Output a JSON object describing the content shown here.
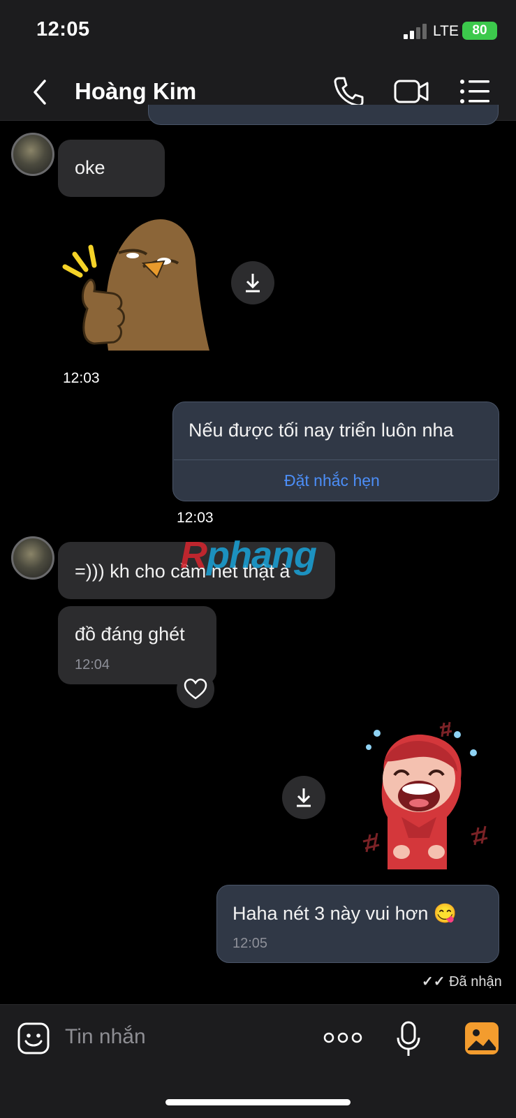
{
  "status_bar": {
    "time": "12:05",
    "network": "LTE",
    "battery": "80"
  },
  "header": {
    "contact_name": "Hoàng Kim",
    "icons": [
      "back-chevron-icon",
      "phone-icon",
      "video-camera-icon",
      "list-menu-icon"
    ]
  },
  "messages": [
    {
      "direction": "received",
      "text": "oke"
    },
    {
      "direction": "received",
      "type": "sticker",
      "sticker": "thumbs-up-bird-sticker",
      "time": "12:03"
    },
    {
      "direction": "sent",
      "text": "Nếu được tối nay triển luôn nha",
      "action": "Đặt nhắc hẹn",
      "time": "12:03"
    },
    {
      "direction": "received",
      "text": "=))) kh cho cầm net thật à"
    },
    {
      "direction": "received",
      "text": "đồ đáng ghét",
      "time": "12:04"
    },
    {
      "direction": "sent",
      "type": "sticker",
      "sticker": "laughing-crying-girl-sticker"
    },
    {
      "direction": "sent",
      "text": "Haha nét 3 này vui hơn 😋",
      "time": "12:05"
    }
  ],
  "delivery_status": "Đã nhận",
  "watermark": "Rphang",
  "input": {
    "placeholder": "Tin nhắn"
  },
  "colors": {
    "background": "#000000",
    "bar": "#1c1c1e",
    "received_bubble": "#2c2c2e",
    "sent_bubble": "#303846",
    "link": "#4c8ef7",
    "battery": "#3cc94c"
  }
}
